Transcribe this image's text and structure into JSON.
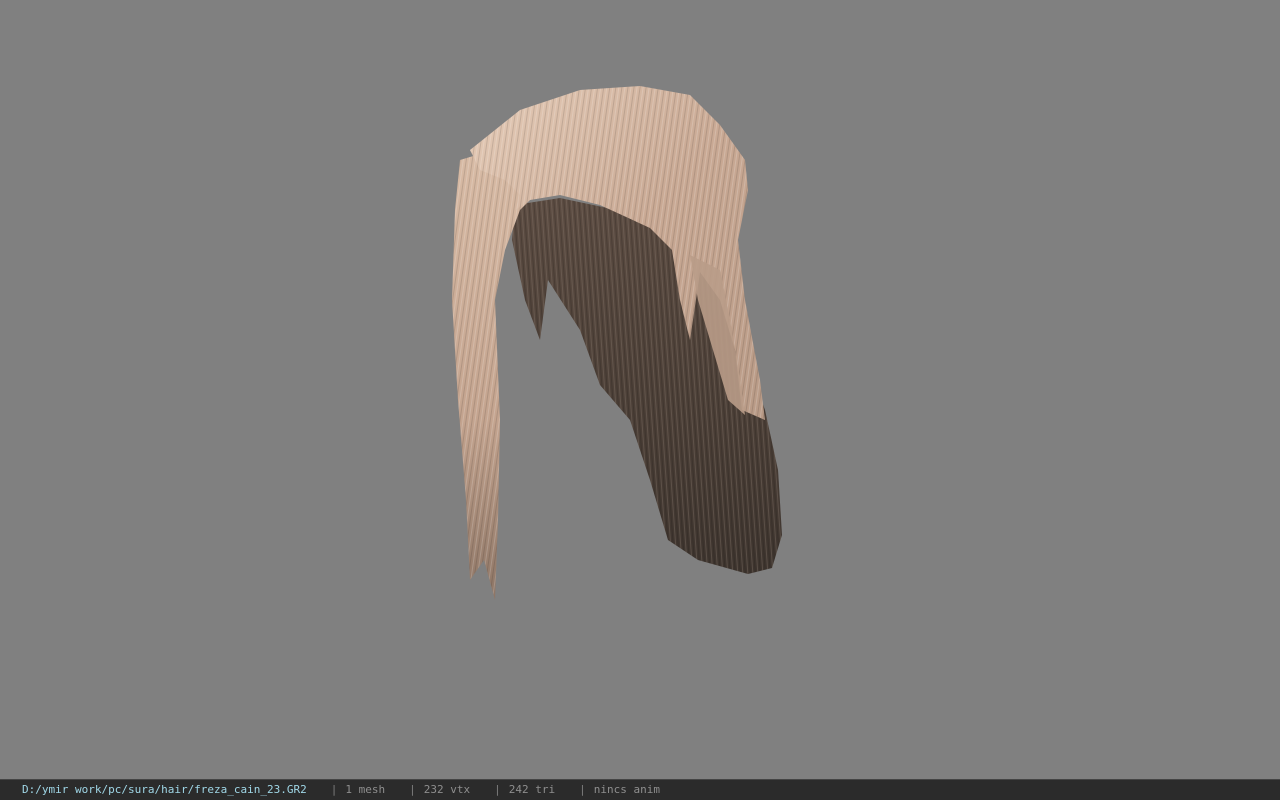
{
  "viewport": {
    "background_color": "#808080",
    "model_name": "hair-mesh"
  },
  "status": {
    "file_path": "D:/ymir work/pc/sura/hair/freza_cain_23.GR2",
    "separator": "|",
    "mesh_count": "1 mesh",
    "vertex_count": "232 vtx",
    "triangle_count": "242 tri",
    "animation": "nincs anim"
  }
}
